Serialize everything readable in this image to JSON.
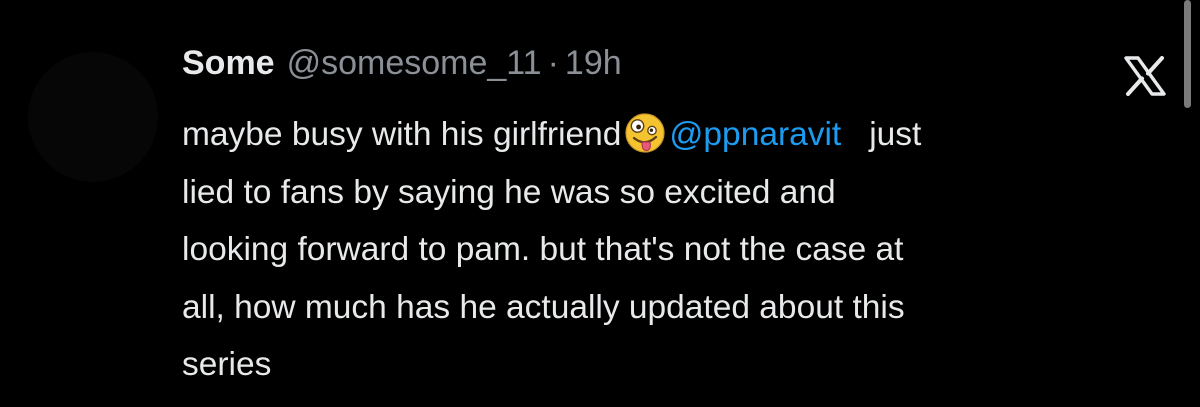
{
  "tweet": {
    "display_name": "Some",
    "handle": "@somesome_11",
    "separator": "·",
    "time": "19h",
    "body_before_emoji": "maybe busy with his girlfriend",
    "emoji_icon": "zany-face-icon",
    "mention": "@ppnaravit",
    "body_after_mention": "just",
    "lines": [
      "lied to fans by saying he was so excited and",
      "looking forward to pam. but that's not the case at",
      "all, how much has he actually updated about this",
      "series"
    ]
  },
  "colors": {
    "background": "#000000",
    "text": "#e7e9ea",
    "secondary_text": "#8b9097",
    "mention": "#1d9bf0"
  },
  "icons": {
    "platform_logo": "x-logo-icon"
  }
}
